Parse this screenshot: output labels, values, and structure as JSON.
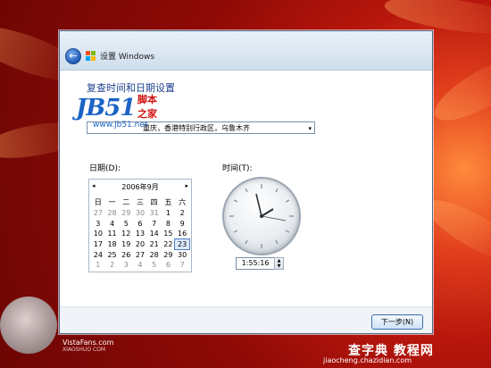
{
  "window": {
    "title": "设置 Windows",
    "heading": "复查时间和日期设置",
    "watermark": {
      "logo": "JB51",
      "tagline_1": "脚本",
      "tagline_2": "之家",
      "url": "www.jb51.net"
    },
    "timezone": {
      "value": "重庆，香港特别行政区，乌鲁木齐",
      "arrow": "▾"
    },
    "date_label": "日期(D):",
    "time_label": "时间(T):",
    "calendar": {
      "month_title": "2006年9月",
      "prev": "◂",
      "next": "▸",
      "weekdays": [
        "日",
        "一",
        "二",
        "三",
        "四",
        "五",
        "六"
      ],
      "weeks": [
        [
          "27",
          "28",
          "29",
          "30",
          "31",
          "1",
          "2"
        ],
        [
          "3",
          "4",
          "5",
          "6",
          "7",
          "8",
          "9"
        ],
        [
          "10",
          "11",
          "12",
          "13",
          "14",
          "15",
          "16"
        ],
        [
          "17",
          "18",
          "19",
          "20",
          "21",
          "22",
          "23"
        ],
        [
          "24",
          "25",
          "26",
          "27",
          "28",
          "29",
          "30"
        ],
        [
          "1",
          "2",
          "3",
          "4",
          "5",
          "6",
          "7"
        ]
      ],
      "selected": "23"
    },
    "time_value": "1:55:16",
    "next_button": "下一步(N)"
  },
  "branding": {
    "vista_name": "VistaFans.com",
    "vista_sub": "XIAOSHUO COM",
    "site_logo": "查字典 教程网",
    "site_url": "jiaocheng.chazidian.com"
  }
}
